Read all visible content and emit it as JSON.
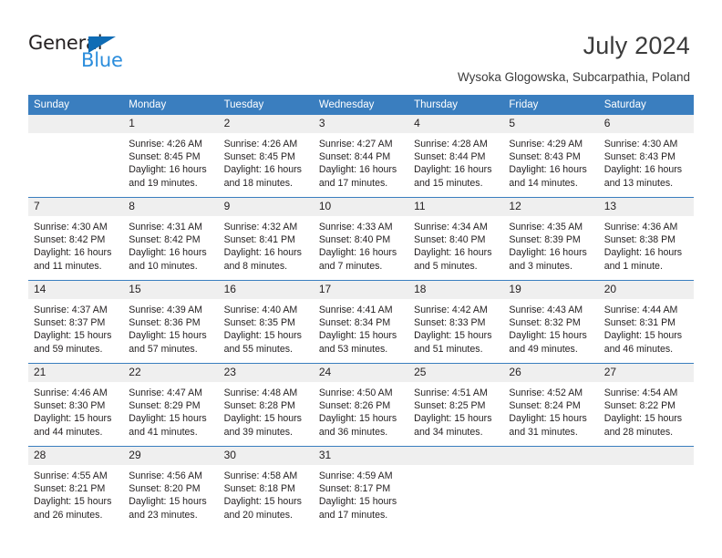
{
  "brand": {
    "name_part1": "General",
    "name_part2": "Blue",
    "triangle_color": "#0f6cb5",
    "blue_text_color": "#2b8ddc"
  },
  "header": {
    "title": "July 2024",
    "subtitle": "Wysoka Glogowska, Subcarpathia, Poland"
  },
  "theme": {
    "header_row_bg": "#3a7ebf",
    "daynum_bg": "#efefef",
    "separator_color": "#3a7ebf",
    "text_color": "#231f20"
  },
  "calendar": {
    "weekday_headers": [
      "Sunday",
      "Monday",
      "Tuesday",
      "Wednesday",
      "Thursday",
      "Friday",
      "Saturday"
    ],
    "labels": {
      "sunrise": "Sunrise:",
      "sunset": "Sunset:",
      "daylight": "Daylight:"
    },
    "weeks": [
      [
        {
          "day": "",
          "sunrise": "",
          "sunset": "",
          "daylight_line1": "",
          "daylight_line2": ""
        },
        {
          "day": "1",
          "sunrise": "Sunrise: 4:26 AM",
          "sunset": "Sunset: 8:45 PM",
          "daylight_line1": "Daylight: 16 hours",
          "daylight_line2": "and 19 minutes."
        },
        {
          "day": "2",
          "sunrise": "Sunrise: 4:26 AM",
          "sunset": "Sunset: 8:45 PM",
          "daylight_line1": "Daylight: 16 hours",
          "daylight_line2": "and 18 minutes."
        },
        {
          "day": "3",
          "sunrise": "Sunrise: 4:27 AM",
          "sunset": "Sunset: 8:44 PM",
          "daylight_line1": "Daylight: 16 hours",
          "daylight_line2": "and 17 minutes."
        },
        {
          "day": "4",
          "sunrise": "Sunrise: 4:28 AM",
          "sunset": "Sunset: 8:44 PM",
          "daylight_line1": "Daylight: 16 hours",
          "daylight_line2": "and 15 minutes."
        },
        {
          "day": "5",
          "sunrise": "Sunrise: 4:29 AM",
          "sunset": "Sunset: 8:43 PM",
          "daylight_line1": "Daylight: 16 hours",
          "daylight_line2": "and 14 minutes."
        },
        {
          "day": "6",
          "sunrise": "Sunrise: 4:30 AM",
          "sunset": "Sunset: 8:43 PM",
          "daylight_line1": "Daylight: 16 hours",
          "daylight_line2": "and 13 minutes."
        }
      ],
      [
        {
          "day": "7",
          "sunrise": "Sunrise: 4:30 AM",
          "sunset": "Sunset: 8:42 PM",
          "daylight_line1": "Daylight: 16 hours",
          "daylight_line2": "and 11 minutes."
        },
        {
          "day": "8",
          "sunrise": "Sunrise: 4:31 AM",
          "sunset": "Sunset: 8:42 PM",
          "daylight_line1": "Daylight: 16 hours",
          "daylight_line2": "and 10 minutes."
        },
        {
          "day": "9",
          "sunrise": "Sunrise: 4:32 AM",
          "sunset": "Sunset: 8:41 PM",
          "daylight_line1": "Daylight: 16 hours",
          "daylight_line2": "and 8 minutes."
        },
        {
          "day": "10",
          "sunrise": "Sunrise: 4:33 AM",
          "sunset": "Sunset: 8:40 PM",
          "daylight_line1": "Daylight: 16 hours",
          "daylight_line2": "and 7 minutes."
        },
        {
          "day": "11",
          "sunrise": "Sunrise: 4:34 AM",
          "sunset": "Sunset: 8:40 PM",
          "daylight_line1": "Daylight: 16 hours",
          "daylight_line2": "and 5 minutes."
        },
        {
          "day": "12",
          "sunrise": "Sunrise: 4:35 AM",
          "sunset": "Sunset: 8:39 PM",
          "daylight_line1": "Daylight: 16 hours",
          "daylight_line2": "and 3 minutes."
        },
        {
          "day": "13",
          "sunrise": "Sunrise: 4:36 AM",
          "sunset": "Sunset: 8:38 PM",
          "daylight_line1": "Daylight: 16 hours",
          "daylight_line2": "and 1 minute."
        }
      ],
      [
        {
          "day": "14",
          "sunrise": "Sunrise: 4:37 AM",
          "sunset": "Sunset: 8:37 PM",
          "daylight_line1": "Daylight: 15 hours",
          "daylight_line2": "and 59 minutes."
        },
        {
          "day": "15",
          "sunrise": "Sunrise: 4:39 AM",
          "sunset": "Sunset: 8:36 PM",
          "daylight_line1": "Daylight: 15 hours",
          "daylight_line2": "and 57 minutes."
        },
        {
          "day": "16",
          "sunrise": "Sunrise: 4:40 AM",
          "sunset": "Sunset: 8:35 PM",
          "daylight_line1": "Daylight: 15 hours",
          "daylight_line2": "and 55 minutes."
        },
        {
          "day": "17",
          "sunrise": "Sunrise: 4:41 AM",
          "sunset": "Sunset: 8:34 PM",
          "daylight_line1": "Daylight: 15 hours",
          "daylight_line2": "and 53 minutes."
        },
        {
          "day": "18",
          "sunrise": "Sunrise: 4:42 AM",
          "sunset": "Sunset: 8:33 PM",
          "daylight_line1": "Daylight: 15 hours",
          "daylight_line2": "and 51 minutes."
        },
        {
          "day": "19",
          "sunrise": "Sunrise: 4:43 AM",
          "sunset": "Sunset: 8:32 PM",
          "daylight_line1": "Daylight: 15 hours",
          "daylight_line2": "and 49 minutes."
        },
        {
          "day": "20",
          "sunrise": "Sunrise: 4:44 AM",
          "sunset": "Sunset: 8:31 PM",
          "daylight_line1": "Daylight: 15 hours",
          "daylight_line2": "and 46 minutes."
        }
      ],
      [
        {
          "day": "21",
          "sunrise": "Sunrise: 4:46 AM",
          "sunset": "Sunset: 8:30 PM",
          "daylight_line1": "Daylight: 15 hours",
          "daylight_line2": "and 44 minutes."
        },
        {
          "day": "22",
          "sunrise": "Sunrise: 4:47 AM",
          "sunset": "Sunset: 8:29 PM",
          "daylight_line1": "Daylight: 15 hours",
          "daylight_line2": "and 41 minutes."
        },
        {
          "day": "23",
          "sunrise": "Sunrise: 4:48 AM",
          "sunset": "Sunset: 8:28 PM",
          "daylight_line1": "Daylight: 15 hours",
          "daylight_line2": "and 39 minutes."
        },
        {
          "day": "24",
          "sunrise": "Sunrise: 4:50 AM",
          "sunset": "Sunset: 8:26 PM",
          "daylight_line1": "Daylight: 15 hours",
          "daylight_line2": "and 36 minutes."
        },
        {
          "day": "25",
          "sunrise": "Sunrise: 4:51 AM",
          "sunset": "Sunset: 8:25 PM",
          "daylight_line1": "Daylight: 15 hours",
          "daylight_line2": "and 34 minutes."
        },
        {
          "day": "26",
          "sunrise": "Sunrise: 4:52 AM",
          "sunset": "Sunset: 8:24 PM",
          "daylight_line1": "Daylight: 15 hours",
          "daylight_line2": "and 31 minutes."
        },
        {
          "day": "27",
          "sunrise": "Sunrise: 4:54 AM",
          "sunset": "Sunset: 8:22 PM",
          "daylight_line1": "Daylight: 15 hours",
          "daylight_line2": "and 28 minutes."
        }
      ],
      [
        {
          "day": "28",
          "sunrise": "Sunrise: 4:55 AM",
          "sunset": "Sunset: 8:21 PM",
          "daylight_line1": "Daylight: 15 hours",
          "daylight_line2": "and 26 minutes."
        },
        {
          "day": "29",
          "sunrise": "Sunrise: 4:56 AM",
          "sunset": "Sunset: 8:20 PM",
          "daylight_line1": "Daylight: 15 hours",
          "daylight_line2": "and 23 minutes."
        },
        {
          "day": "30",
          "sunrise": "Sunrise: 4:58 AM",
          "sunset": "Sunset: 8:18 PM",
          "daylight_line1": "Daylight: 15 hours",
          "daylight_line2": "and 20 minutes."
        },
        {
          "day": "31",
          "sunrise": "Sunrise: 4:59 AM",
          "sunset": "Sunset: 8:17 PM",
          "daylight_line1": "Daylight: 15 hours",
          "daylight_line2": "and 17 minutes."
        },
        {
          "day": "",
          "sunrise": "",
          "sunset": "",
          "daylight_line1": "",
          "daylight_line2": ""
        },
        {
          "day": "",
          "sunrise": "",
          "sunset": "",
          "daylight_line1": "",
          "daylight_line2": ""
        },
        {
          "day": "",
          "sunrise": "",
          "sunset": "",
          "daylight_line1": "",
          "daylight_line2": ""
        }
      ]
    ]
  }
}
